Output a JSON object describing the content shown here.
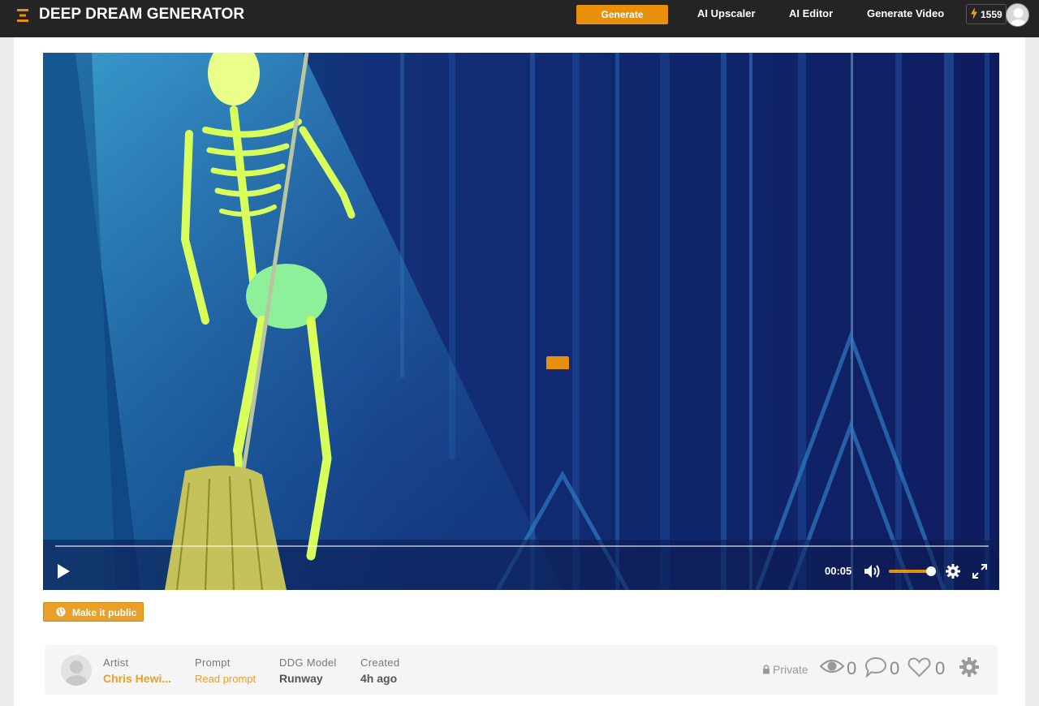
{
  "header": {
    "brand": "DEEP DREAM GENERATOR",
    "generate_label": "Generate",
    "nav": [
      "AI Upscaler",
      "AI Editor",
      "Generate Video"
    ],
    "credits": "1559",
    "accent_color": "#e8900c"
  },
  "player": {
    "time": "00:05",
    "progress_fraction": 0.0,
    "volume_fraction": 1.0,
    "icons": [
      "play-icon",
      "volume-icon",
      "gear-icon",
      "fullscreen-icon"
    ]
  },
  "actions": {
    "make_public_label": "Make it public"
  },
  "info": {
    "artist_label": "Artist",
    "artist_value": "Chris Hewi...",
    "prompt_label": "Prompt",
    "prompt_link": "Read prompt",
    "model_label": "DDG Model",
    "model_value": "Runway",
    "created_label": "Created",
    "created_value": "4h ago",
    "visibility": "Private",
    "views": "0",
    "comments": "0",
    "likes": "0"
  }
}
